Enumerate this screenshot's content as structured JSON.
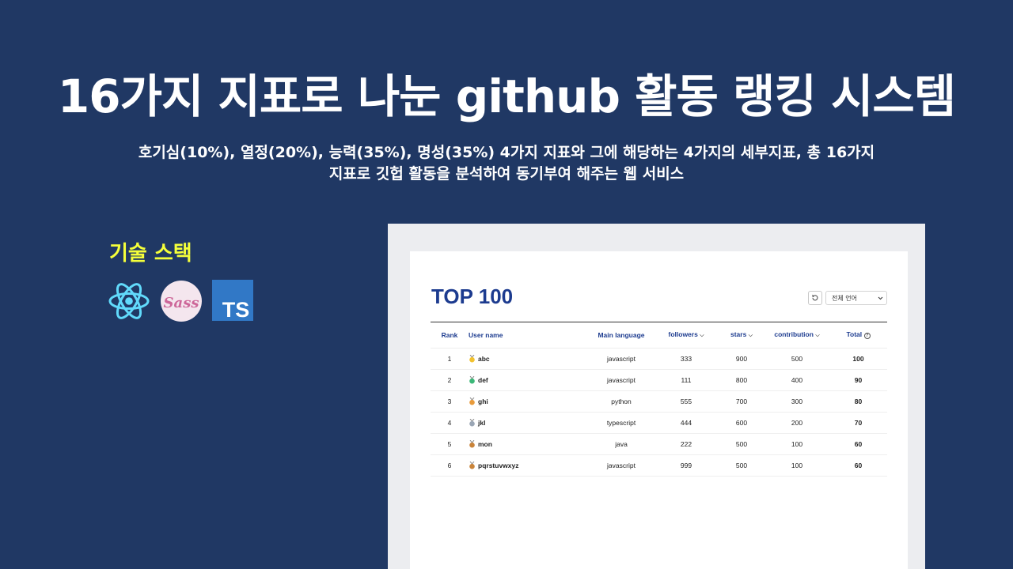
{
  "headline": "16가지 지표로 나눈 github 활동 랭킹 시스템",
  "subtitle": {
    "line1": "호기심(10%), 열정(20%), 능력(35%), 명성(35%) 4가지 지표와 그에 해당하는 4가지의 세부지표, 총 16가지",
    "line2": "지표로 깃헙 활동을 분석하여 동기부여 해주는 웹 서비스"
  },
  "stack": {
    "title": "기술 스택",
    "icons": [
      "react-icon",
      "sass-icon",
      "typescript-icon"
    ],
    "sass_label": "Sass",
    "ts_label": "TS"
  },
  "ranking": {
    "title": "TOP 100",
    "language_select": "전체 언어",
    "columns": {
      "rank": "Rank",
      "user": "User name",
      "language": "Main language",
      "followers": "followers",
      "stars": "stars",
      "contribution": "contribution",
      "total": "Total"
    },
    "rows": [
      {
        "rank": "1",
        "user": "abc",
        "language": "javascript",
        "followers": "333",
        "stars": "900",
        "contribution": "500",
        "total": "100",
        "tier_color": "#f2c230"
      },
      {
        "rank": "2",
        "user": "def",
        "language": "javascript",
        "followers": "111",
        "stars": "800",
        "contribution": "400",
        "total": "90",
        "tier_color": "#3cb878"
      },
      {
        "rank": "3",
        "user": "ghi",
        "language": "python",
        "followers": "555",
        "stars": "700",
        "contribution": "300",
        "total": "80",
        "tier_color": "#e89b3c"
      },
      {
        "rank": "4",
        "user": "jkl",
        "language": "typescript",
        "followers": "444",
        "stars": "600",
        "contribution": "200",
        "total": "70",
        "tier_color": "#9aa6b5"
      },
      {
        "rank": "5",
        "user": "mon",
        "language": "java",
        "followers": "222",
        "stars": "500",
        "contribution": "100",
        "total": "60",
        "tier_color": "#c9843a"
      },
      {
        "rank": "6",
        "user": "pqrstuvwxyz",
        "language": "javascript",
        "followers": "999",
        "stars": "500",
        "contribution": "100",
        "total": "60",
        "tier_color": "#c9843a"
      }
    ]
  },
  "colors": {
    "background": "#203864",
    "accent_yellow": "#f5ff3a",
    "title_blue": "#1c3b8f"
  }
}
